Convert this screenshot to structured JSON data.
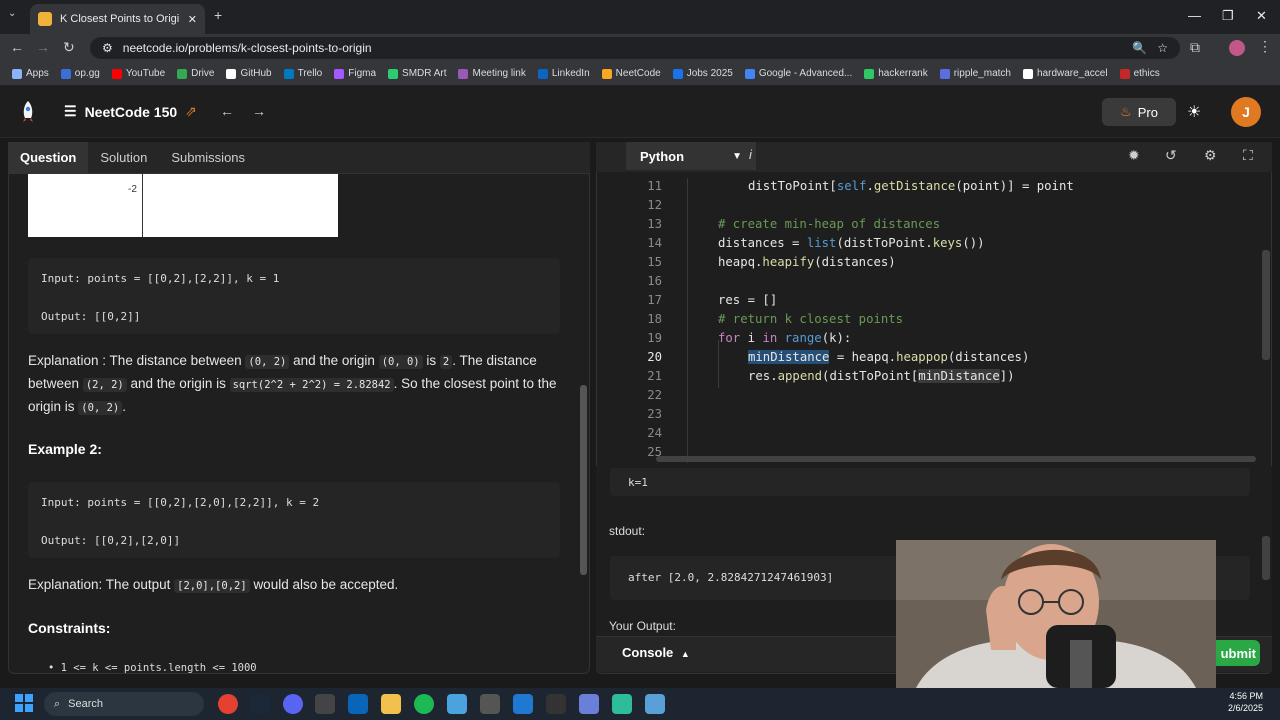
{
  "browser": {
    "tab_title": "K Closest Points to Origin - Ne",
    "url": "neetcode.io/problems/k-closest-points-to-origin",
    "bookmarks": [
      "Apps",
      "op.gg",
      "YouTube",
      "Drive",
      "GitHub",
      "Trello",
      "Figma",
      "SMDR Art",
      "Meeting link",
      "LinkedIn",
      "NeetCode",
      "Jobs 2025",
      "Google - Advanced...",
      "hackerrank",
      "ripple_match",
      "hardware_accel",
      "ethics"
    ]
  },
  "header": {
    "list_name": "NeetCode 150",
    "pro_label": "Pro",
    "avatar_letter": "J"
  },
  "left": {
    "tabs": [
      "Question",
      "Solution",
      "Submissions"
    ],
    "graph_tick": "-2",
    "ex1_input": "Input: points = [[0,2],[2,2]], k = 1",
    "ex1_output": "Output: [[0,2]]",
    "exp1": {
      "a": "Explanation : The distance between",
      "code1": "(0, 2)",
      "b": "and the origin",
      "code2": "(0, 0)",
      "c": "is",
      "code3": "2",
      "d": ". The distance between",
      "code4": "(2, 2)",
      "e": "and the origin is",
      "code5": "sqrt(2^2 + 2^2) = 2.82842",
      "f": ". So the closest point to the origin is",
      "code6": "(0, 2)",
      "g": "."
    },
    "example2_heading": "Example 2:",
    "ex2_input": "Input: points = [[0,2],[2,0],[2,2]], k = 2",
    "ex2_output": "Output: [[0,2],[2,0]]",
    "exp2": {
      "a": "Explanation: The output",
      "code1": "[2,0],[0,2]",
      "b": "would also be accepted."
    },
    "constraints_heading": "Constraints:",
    "constraint1": "1 <= k <= points.length <= 1000"
  },
  "editor": {
    "language": "Python",
    "info": "i",
    "line_numbers": [
      "11",
      "12",
      "13",
      "14",
      "15",
      "16",
      "17",
      "18",
      "19",
      "20",
      "21",
      "22",
      "23",
      "24",
      "25"
    ]
  },
  "console": {
    "input_value": "k=1",
    "stdout_label": "stdout:",
    "stdout_value": "after [2.0, 2.8284271247461903]",
    "your_output_label": "Your Output:",
    "console_label": "Console",
    "submit_label": "ubmit"
  },
  "taskbar": {
    "search_placeholder": "Search",
    "time": "4:56 PM",
    "date": "2/6/2025"
  }
}
